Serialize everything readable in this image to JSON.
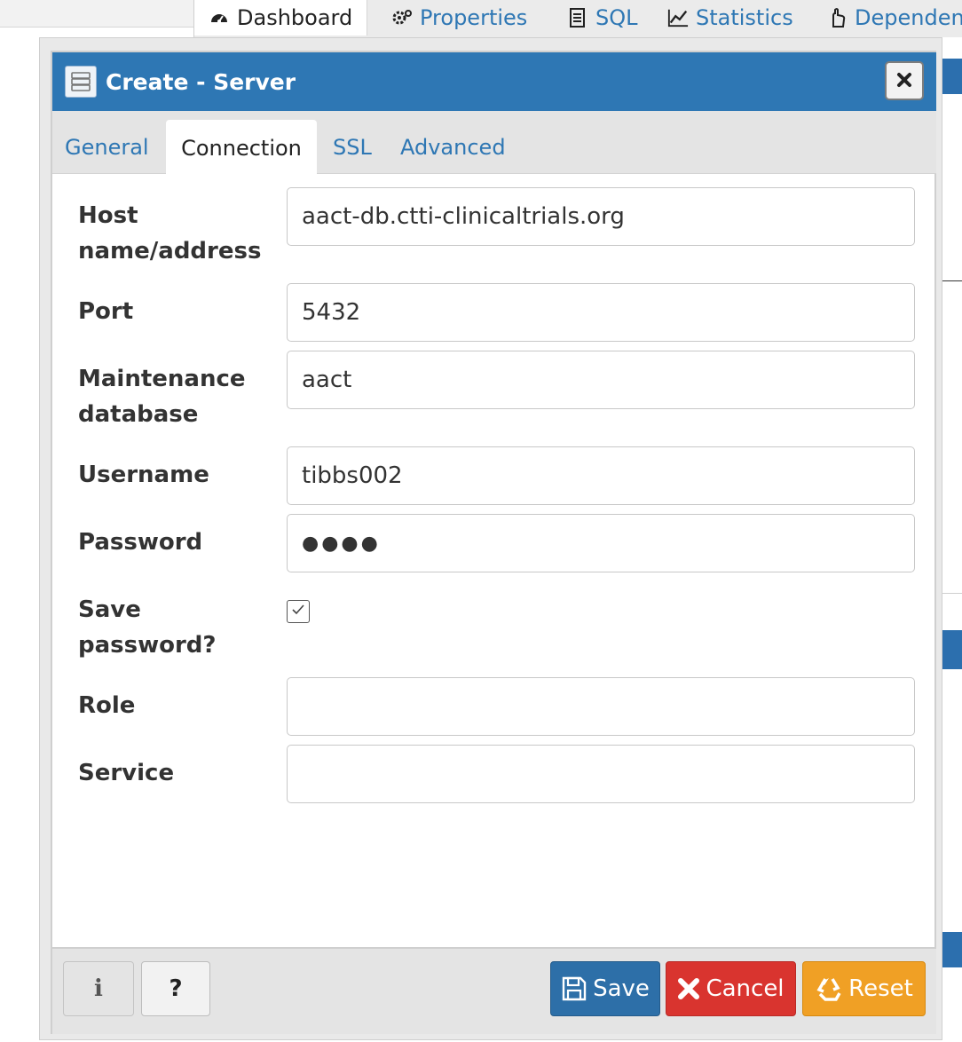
{
  "background": {
    "tabs": [
      {
        "label": "Dashboard",
        "icon": "dashboard-icon",
        "active": true
      },
      {
        "label": "Properties",
        "icon": "gears-icon"
      },
      {
        "label": "SQL",
        "icon": "file-text-icon"
      },
      {
        "label": "Statistics",
        "icon": "line-chart-icon"
      },
      {
        "label": "Dependen",
        "icon": "hand-pointer-icon"
      }
    ]
  },
  "dialog": {
    "title": "Create - Server",
    "title_icon": "server-icon",
    "close_glyph": "×",
    "tabs": [
      {
        "label": "General"
      },
      {
        "label": "Connection",
        "active": true
      },
      {
        "label": "SSL"
      },
      {
        "label": "Advanced"
      }
    ],
    "fields": {
      "host": {
        "label_line1": "Host",
        "label_line2": "name/address",
        "value": "aact-db.ctti-clinicaltrials.org"
      },
      "port": {
        "label": "Port",
        "value": "5432"
      },
      "maintenance_db": {
        "label_line1": "Maintenance",
        "label_line2": "database",
        "value": "aact"
      },
      "username": {
        "label": "Username",
        "value": "tibbs002"
      },
      "password": {
        "label": "Password",
        "value": "●●●●"
      },
      "save_password": {
        "label_line1": "Save",
        "label_line2": "password?",
        "checked": true
      },
      "role": {
        "label": "Role",
        "value": ""
      },
      "service": {
        "label": "Service",
        "value": ""
      }
    },
    "footer": {
      "info_label": "i",
      "help_label": "?",
      "save_label": "Save",
      "cancel_label": "Cancel",
      "reset_label": "Reset"
    }
  },
  "colors": {
    "primary": "#2e77b4",
    "save": "#2d6fa8",
    "cancel": "#d9342f",
    "reset": "#f0a025"
  }
}
